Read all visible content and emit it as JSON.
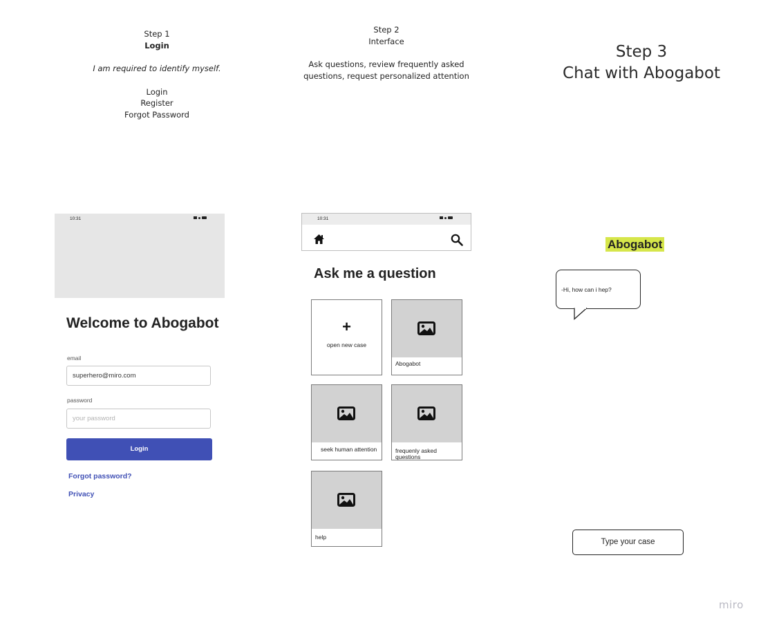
{
  "step1": {
    "step": "Step 1",
    "title": "Login",
    "desc": "I am required to identify myself.",
    "options": [
      "Login",
      "Register",
      "Forgot Password"
    ]
  },
  "step2": {
    "step": "Step 2",
    "title": "Interface",
    "desc_line1": "Ask questions, review frequently asked",
    "desc_line2": "questions, request personalized attention"
  },
  "step3": {
    "step": "Step 3",
    "title": "Chat with Abogabot"
  },
  "login_screen": {
    "time": "10:31",
    "welcome": "Welcome to Abogabot",
    "email_label": "email",
    "email_value": "superhero@miro.com",
    "password_label": "password",
    "password_placeholder": "your password",
    "login_button": "Login",
    "forgot_link": "Forgot password?",
    "privacy_link": "Privacy"
  },
  "interface_screen": {
    "time": "10:31",
    "heading": "Ask me a question",
    "new_case_symbol": "+",
    "new_case_label": "open new case",
    "tiles": [
      "Abogabot",
      "seek human attention",
      "frequenly asked questions",
      "help"
    ]
  },
  "chat": {
    "bot_name": "Abogabot",
    "bot_message": "-Hi, how can i hep?",
    "input_label": "Type your case",
    "highlight_color": "#d6e64a"
  },
  "brand": "miro",
  "colors": {
    "accent": "#4050b5"
  }
}
